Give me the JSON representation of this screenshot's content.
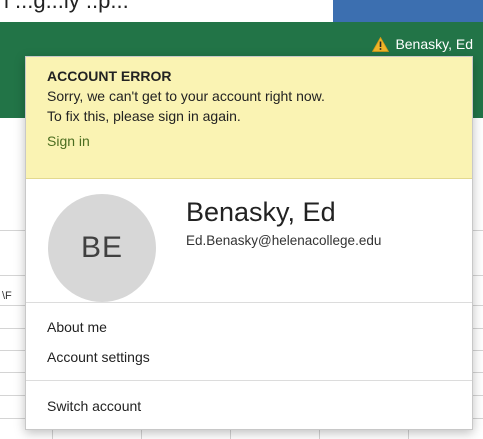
{
  "top_strip": {
    "partial_text": "l ...g...ly ..p..."
  },
  "header": {
    "user_name": "Benasky, Ed",
    "warning_icon": "warning-triangle-icon",
    "bar_color": "#227447"
  },
  "background": {
    "cell_text": "\\F"
  },
  "account_popup": {
    "error": {
      "title": "ACCOUNT ERROR",
      "line1": "Sorry, we can't get to your account right now.",
      "line2": "To fix this, please sign in again.",
      "sign_in_label": "Sign in",
      "banner_color": "#faf3b3"
    },
    "profile": {
      "initials": "BE",
      "name": "Benasky, Ed",
      "email": "Ed.Benasky@helenacollege.edu"
    },
    "menu": {
      "about_me": "About me",
      "account_settings": "Account settings",
      "switch_account": "Switch account"
    }
  }
}
